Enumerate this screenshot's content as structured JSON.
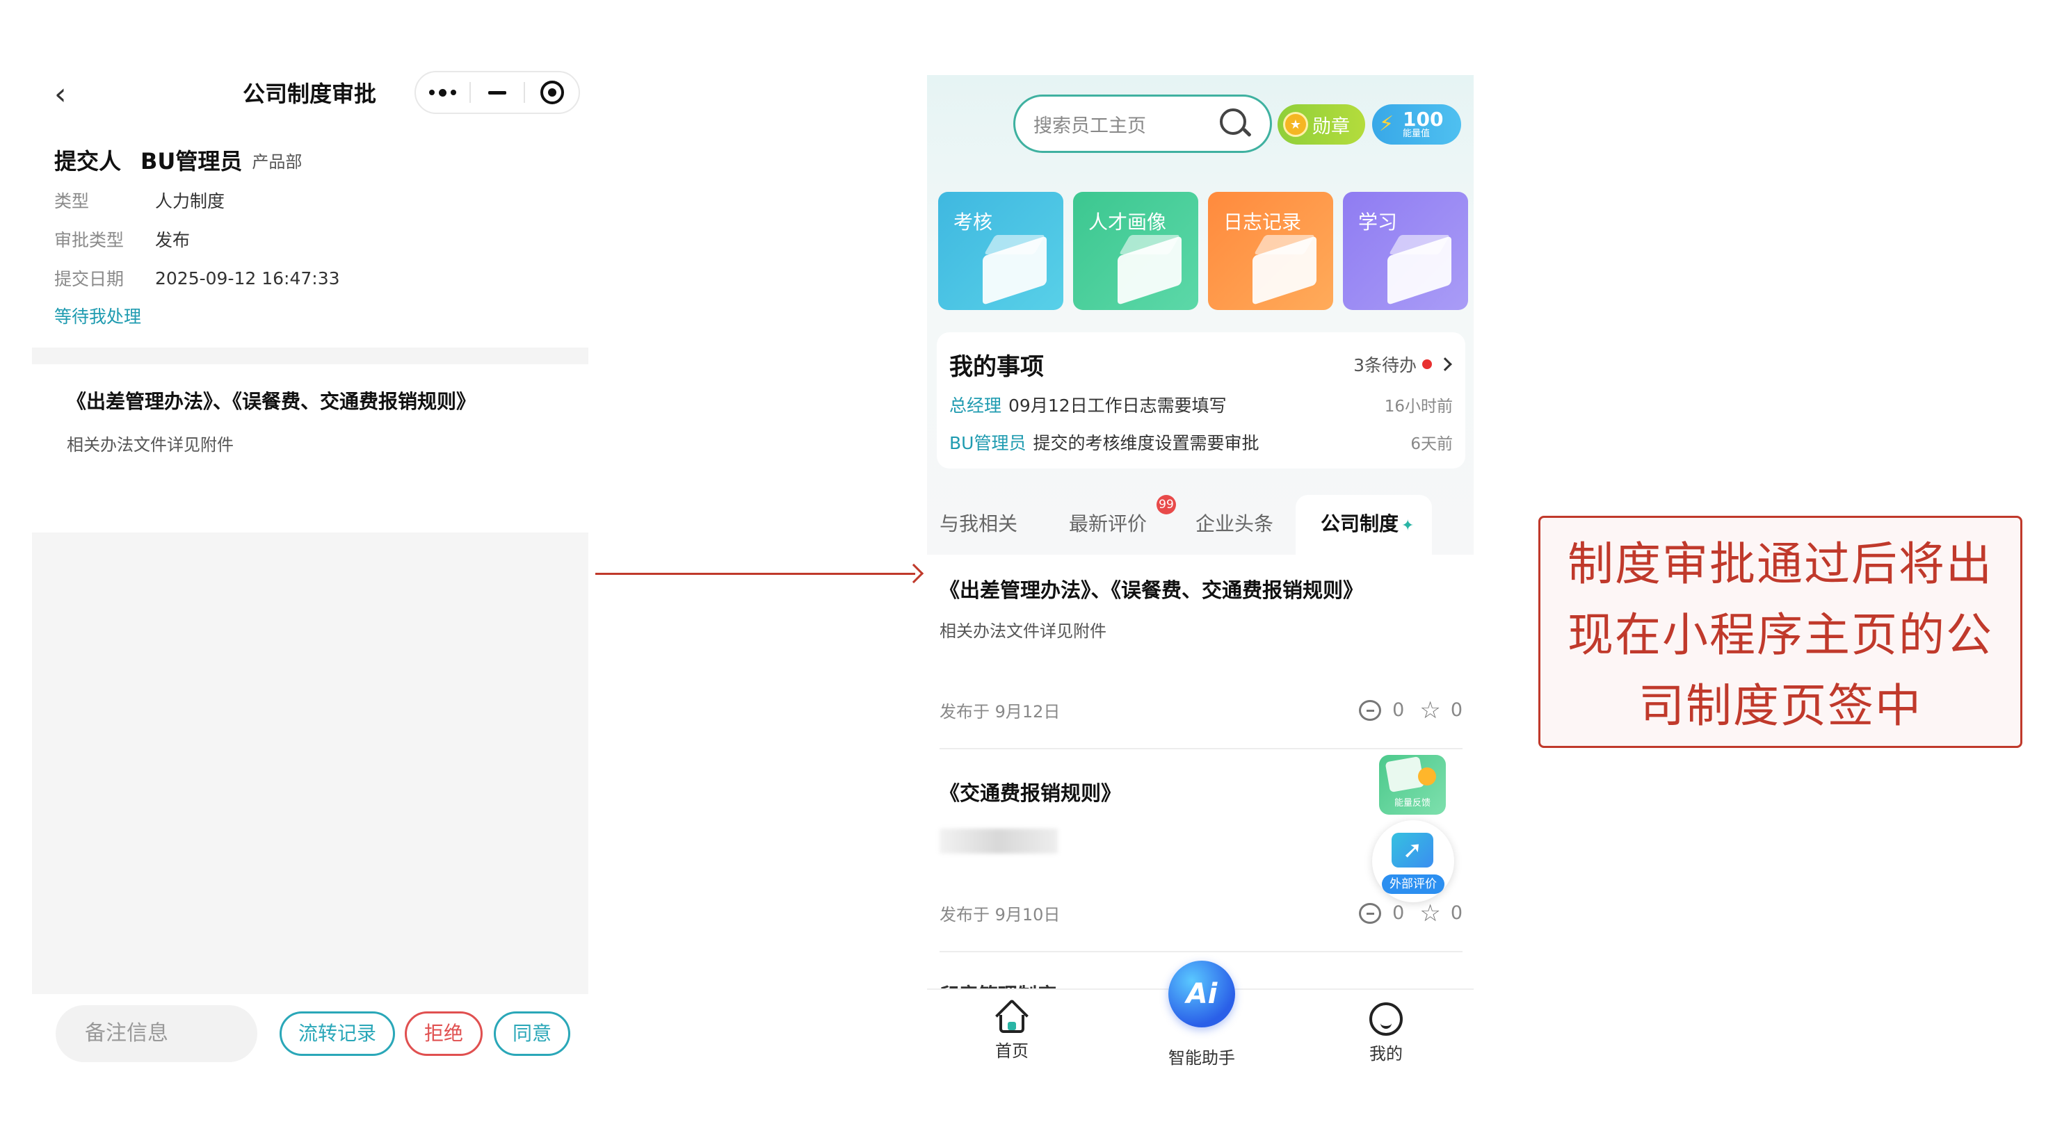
{
  "left_panel": {
    "nav": {
      "title": "公司制度审批"
    },
    "submitter": {
      "label": "提交人",
      "name": "BU管理员",
      "dept": "产品部"
    },
    "fields": [
      {
        "key": "类型",
        "value": "人力制度"
      },
      {
        "key": "审批类型",
        "value": "发布"
      },
      {
        "key": "提交日期",
        "value": "2025-09-12 16:47:33"
      }
    ],
    "status": "等待我处理",
    "doc": {
      "title": "《出差管理办法》、《误餐费、交通费报销规则》",
      "desc": "相关办法文件详见附件"
    },
    "actions": {
      "remark_placeholder": "备注信息",
      "flow": "流转记录",
      "reject": "拒绝",
      "agree": "同意"
    }
  },
  "right_panel": {
    "search_placeholder": "搜索员工主页",
    "medal_label": "勋章",
    "energy": {
      "value": "100",
      "label": "能量值"
    },
    "tiles": [
      "考核",
      "人才画像",
      "日志记录",
      "学习"
    ],
    "todo": {
      "title": "我的事项",
      "count": "3条待办",
      "items": [
        {
          "who": "总经理",
          "text": "09月12日工作日志需要填写",
          "time": "16小时前"
        },
        {
          "who": "BU管理员",
          "text": "提交的考核维度设置需要审批",
          "time": "6天前"
        }
      ]
    },
    "tabs": [
      {
        "label": "与我相关"
      },
      {
        "label": "最新评价",
        "badge": "99"
      },
      {
        "label": "企业头条"
      },
      {
        "label": "公司制度"
      }
    ],
    "posts": [
      {
        "title": "《出差管理办法》、《误餐费、交通费报销规则》",
        "desc": "相关办法文件详见附件",
        "date": "发布于 9月12日",
        "comments": "0",
        "stars": "0"
      },
      {
        "title": "《交通费报销规则》",
        "desc": "",
        "date": "发布于 9月10日",
        "comments": "0",
        "stars": "0"
      }
    ],
    "cutoff_title": "印章管理制度",
    "float_feedback": "能量反馈",
    "float_eval": "外部评价",
    "bottom_nav": {
      "home": "首页",
      "ai": "智能助手",
      "ai_icon": "Ai",
      "me": "我的"
    }
  },
  "note": {
    "lines": [
      "制度审批通过后将出",
      "现在小程序主页的公",
      "司制度页签中"
    ]
  },
  "colors": {
    "accent": "#2aa7b8",
    "reject": "#e05050",
    "annotation": "#c0392b"
  }
}
